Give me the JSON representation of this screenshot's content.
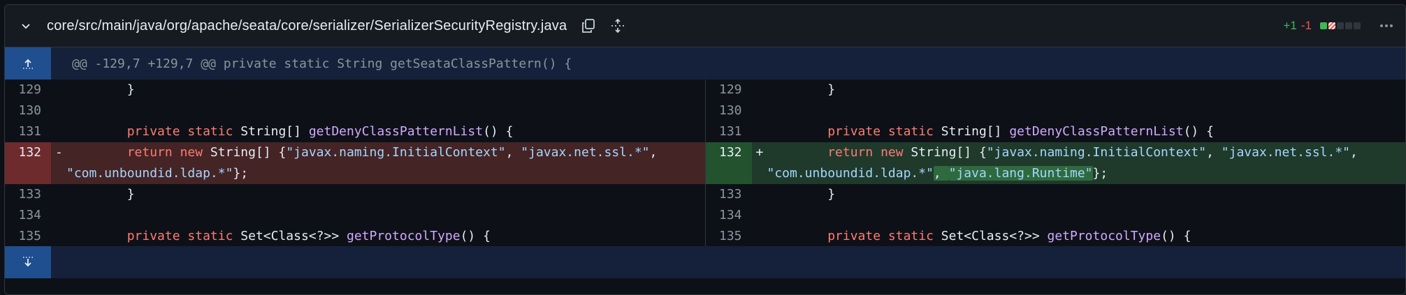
{
  "header": {
    "file_path": "core/src/main/java/org/apache/seata/core/serializer/SerializerSecurityRegistry.java",
    "additions": "+1",
    "deletions": "-1"
  },
  "hunk": {
    "label": "@@ -129,7 +129,7 @@ private static String getSeataClassPattern() {"
  },
  "colors": {
    "add": "#3fb950",
    "del": "#f85149",
    "accent": "#1f4f8f"
  },
  "left": {
    "lines": [
      {
        "num": "129",
        "sign": "",
        "segments": [
          {
            "t": "        }",
            "c": "pl"
          }
        ]
      },
      {
        "num": "130",
        "sign": "",
        "segments": []
      },
      {
        "num": "131",
        "sign": "",
        "segments": [
          {
            "t": "        ",
            "c": "pl"
          },
          {
            "t": "private",
            "c": "kw"
          },
          {
            "t": " ",
            "c": "pl"
          },
          {
            "t": "static",
            "c": "kw"
          },
          {
            "t": " String[] ",
            "c": "ty"
          },
          {
            "t": "getDenyClassPatternList",
            "c": "fn"
          },
          {
            "t": "() {",
            "c": "pl"
          }
        ]
      },
      {
        "num": "132",
        "sign": "-",
        "type": "deleted",
        "segments": [
          {
            "t": "        ",
            "c": "pl"
          },
          {
            "t": "return",
            "c": "kw"
          },
          {
            "t": " ",
            "c": "pl"
          },
          {
            "t": "new",
            "c": "kw"
          },
          {
            "t": " String[] {",
            "c": "pl"
          },
          {
            "t": "\"javax.naming.InitialContext\"",
            "c": "str"
          },
          {
            "t": ", ",
            "c": "pl"
          },
          {
            "t": "\"javax.net.ssl.*\"",
            "c": "str"
          },
          {
            "t": ",\n",
            "c": "pl"
          },
          {
            "t": "\"com.unboundid.ldap.*\"",
            "c": "str"
          },
          {
            "t": "};",
            "c": "pl"
          }
        ]
      },
      {
        "num": "133",
        "sign": "",
        "segments": [
          {
            "t": "        }",
            "c": "pl"
          }
        ]
      },
      {
        "num": "134",
        "sign": "",
        "segments": []
      },
      {
        "num": "135",
        "sign": "",
        "segments": [
          {
            "t": "        ",
            "c": "pl"
          },
          {
            "t": "private",
            "c": "kw"
          },
          {
            "t": " ",
            "c": "pl"
          },
          {
            "t": "static",
            "c": "kw"
          },
          {
            "t": " Set<Class<?>> ",
            "c": "ty"
          },
          {
            "t": "getProtocolType",
            "c": "fn"
          },
          {
            "t": "() {",
            "c": "pl"
          }
        ]
      }
    ]
  },
  "right": {
    "lines": [
      {
        "num": "129",
        "sign": "",
        "segments": [
          {
            "t": "        }",
            "c": "pl"
          }
        ]
      },
      {
        "num": "130",
        "sign": "",
        "segments": []
      },
      {
        "num": "131",
        "sign": "",
        "segments": [
          {
            "t": "        ",
            "c": "pl"
          },
          {
            "t": "private",
            "c": "kw"
          },
          {
            "t": " ",
            "c": "pl"
          },
          {
            "t": "static",
            "c": "kw"
          },
          {
            "t": " String[] ",
            "c": "ty"
          },
          {
            "t": "getDenyClassPatternList",
            "c": "fn"
          },
          {
            "t": "() {",
            "c": "pl"
          }
        ]
      },
      {
        "num": "132",
        "sign": "+",
        "type": "added",
        "segments": [
          {
            "t": "        ",
            "c": "pl"
          },
          {
            "t": "return",
            "c": "kw"
          },
          {
            "t": " ",
            "c": "pl"
          },
          {
            "t": "new",
            "c": "kw"
          },
          {
            "t": " String[] {",
            "c": "pl"
          },
          {
            "t": "\"javax.naming.InitialContext\"",
            "c": "str"
          },
          {
            "t": ", ",
            "c": "pl"
          },
          {
            "t": "\"javax.net.ssl.*\"",
            "c": "str"
          },
          {
            "t": ",\n",
            "c": "pl"
          },
          {
            "t": "\"com.unboundid.ldap.*\"",
            "c": "str"
          },
          {
            "t": ", ",
            "c": "pl",
            "hl": true
          },
          {
            "t": "\"java.lang.Runtime\"",
            "c": "str",
            "hl": true
          },
          {
            "t": "};",
            "c": "pl"
          }
        ]
      },
      {
        "num": "133",
        "sign": "",
        "segments": [
          {
            "t": "        }",
            "c": "pl"
          }
        ]
      },
      {
        "num": "134",
        "sign": "",
        "segments": []
      },
      {
        "num": "135",
        "sign": "",
        "segments": [
          {
            "t": "        ",
            "c": "pl"
          },
          {
            "t": "private",
            "c": "kw"
          },
          {
            "t": " ",
            "c": "pl"
          },
          {
            "t": "static",
            "c": "kw"
          },
          {
            "t": " Set<Class<?>> ",
            "c": "ty"
          },
          {
            "t": "getProtocolType",
            "c": "fn"
          },
          {
            "t": "() {",
            "c": "pl"
          }
        ]
      }
    ]
  }
}
